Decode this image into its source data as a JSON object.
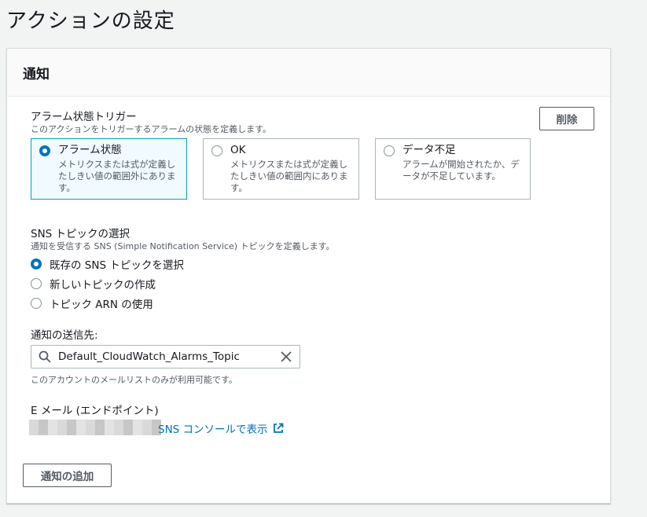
{
  "page_title": "アクションの設定",
  "panel": {
    "title": "通知",
    "remove_button": "削除",
    "alarm_trigger": {
      "label": "アラーム状態トリガー",
      "description": "このアクションをトリガーするアラームの状態を定義します。",
      "options": [
        {
          "title": "アラーム状態",
          "description": "メトリクスまたは式が定義したしきい値の範囲外にあります。",
          "selected": true
        },
        {
          "title": "OK",
          "description": "メトリクスまたは式が定義したしきい値の範囲内にあります。",
          "selected": false
        },
        {
          "title": "データ不足",
          "description": "アラームが開始されたか、データが不足しています。",
          "selected": false
        }
      ]
    },
    "sns_topic": {
      "label": "SNS トピックの選択",
      "description": "通知を受信する SNS (Simple Notification Service) トピックを定義します。",
      "options": [
        {
          "label": "既存の SNS トピックを選択",
          "selected": true
        },
        {
          "label": "新しいトピックの作成",
          "selected": false
        },
        {
          "label": "トピック ARN の使用",
          "selected": false
        }
      ]
    },
    "send_to": {
      "label": "通知の送信先:",
      "value": "Default_CloudWatch_Alarms_Topic",
      "help": "このアカウントのメールリストのみが利用可能です。"
    },
    "email": {
      "label": "E メール (エンドポイント)",
      "console_link": "SNS コンソールで表示"
    },
    "add_button": "通知の追加"
  },
  "colors": {
    "accent": "#0073bb",
    "selected_tile_border": "#00a1c9",
    "selected_tile_bg": "#f1faff"
  },
  "icons": [
    "search-icon",
    "clear-icon",
    "external-link-icon",
    "radio-icon"
  ]
}
